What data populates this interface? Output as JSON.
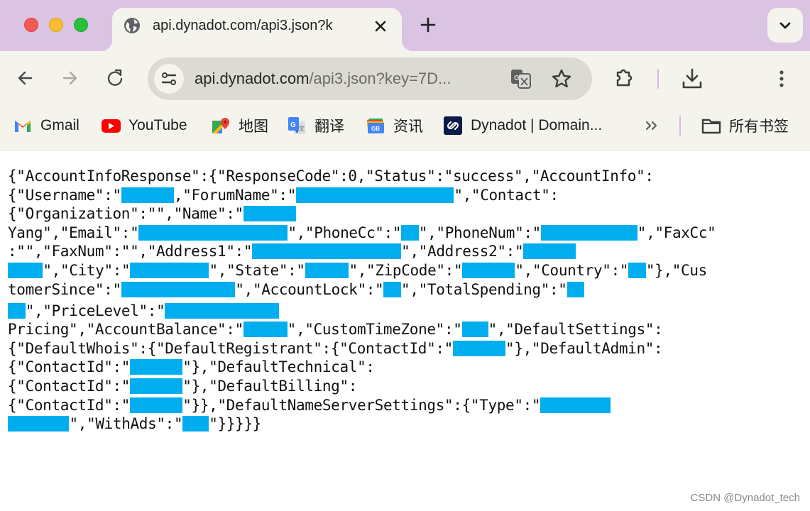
{
  "window": {
    "controls": [
      "close",
      "minimize",
      "maximize"
    ]
  },
  "tabs": [
    {
      "title": "api.dynadot.com/api3.json?k",
      "icon": "globe-icon",
      "active": true
    }
  ],
  "tab_strip": {
    "new_tab_label": "+",
    "tab_search_icon": "chevron-down-icon"
  },
  "toolbar": {
    "url_host": "api.dynadot.com",
    "url_rest": "/api3.json?key=7D...",
    "icons": [
      "back-arrow-icon",
      "forward-arrow-icon",
      "reload-icon",
      "site-info-icon",
      "translate-icon",
      "star-icon",
      "extensions-icon",
      "download-icon",
      "more-menu-icon"
    ]
  },
  "bookmarks": {
    "items": [
      {
        "label": "Gmail",
        "icon": "gmail-icon"
      },
      {
        "label": "YouTube",
        "icon": "youtube-icon"
      },
      {
        "label": "地图",
        "icon": "google-maps-icon"
      },
      {
        "label": "翻译",
        "icon": "google-translate-icon"
      },
      {
        "label": "资讯",
        "icon": "google-news-icon"
      },
      {
        "label": "Dynadot | Domain...",
        "icon": "dynadot-icon"
      }
    ],
    "overflow_label": "»",
    "all_bookmarks_label": "所有书签"
  },
  "content": {
    "redaction_color": "#00aeef",
    "lines": [
      [
        {
          "t": "{\"AccountInfoResponse\":{\"ResponseCode\":0,\"Status\":\"success\",\"AccountInfo\":"
        }
      ],
      [
        {
          "t": "{\"Username\":\""
        },
        {
          "r": 6
        },
        {
          "t": ",\"ForumName\":\""
        },
        {
          "r": 18
        },
        {
          "t": "\",\"Contact\":"
        }
      ],
      [
        {
          "t": "{\"Organization\":\"\",\"Name\":\""
        },
        {
          "r": 6
        }
      ],
      [
        {
          "t": "Yang\",\"Email\":\""
        },
        {
          "r": 17
        },
        {
          "t": "\",\"PhoneCc\":\""
        },
        {
          "r": 2
        },
        {
          "t": "\",\"PhoneNum\":\""
        },
        {
          "r": 11
        },
        {
          "t": "\",\"FaxCc\""
        }
      ],
      [
        {
          "t": ":\"\",\"FaxNum\":\"\",\"Address1\":\""
        },
        {
          "r": 17
        },
        {
          "t": "\",\"Address2\":\""
        },
        {
          "r": 6
        }
      ],
      [
        {
          "r": 4
        },
        {
          "t": "\",\"City\":\""
        },
        {
          "r": 9
        },
        {
          "t": "\",\"State\":\""
        },
        {
          "r": 5
        },
        {
          "t": "\",\"ZipCode\":\""
        },
        {
          "r": 6
        },
        {
          "t": "\",\"Country\":\""
        },
        {
          "r": 2
        },
        {
          "t": "\"},\"Cus"
        }
      ],
      [
        {
          "t": "tomerSince\":\""
        },
        {
          "r": 13
        },
        {
          "t": "\",\"AccountLock\":\""
        },
        {
          "r": 2
        },
        {
          "t": "\",\"TotalSpending\":\""
        },
        {
          "r": 2
        }
      ],
      [
        {
          "r": 2
        },
        {
          "t": "\",\"PriceLevel\":\""
        },
        {
          "r": 13
        }
      ],
      [
        {
          "t": "Pricing\",\"AccountBalance\":\""
        },
        {
          "r": 5
        },
        {
          "t": "\",\"CustomTimeZone\":\""
        },
        {
          "r": 3
        },
        {
          "t": "\",\"DefaultSettings\":"
        }
      ],
      [
        {
          "t": "{\"DefaultWhois\":{\"DefaultRegistrant\":{\"ContactId\":\""
        },
        {
          "r": 6
        },
        {
          "t": "\"},\"DefaultAdmin\":"
        }
      ],
      [
        {
          "t": "{\"ContactId\":\""
        },
        {
          "r": 6
        },
        {
          "t": "\"},\"DefaultTechnical\":"
        }
      ],
      [
        {
          "t": "{\"ContactId\":\""
        },
        {
          "r": 6
        },
        {
          "t": "\"},\"DefaultBilling\":"
        }
      ],
      [
        {
          "t": "{\"ContactId\":\""
        },
        {
          "r": 6
        },
        {
          "t": "\"}},\"DefaultNameServerSettings\":{\"Type\":\""
        },
        {
          "r": 8
        }
      ],
      [
        {
          "r": 7
        },
        {
          "t": "\",\"WithAds\":\""
        },
        {
          "r": 3
        },
        {
          "t": "\"}}}}}"
        }
      ]
    ]
  },
  "watermark": "CSDN @Dynadot_tech"
}
